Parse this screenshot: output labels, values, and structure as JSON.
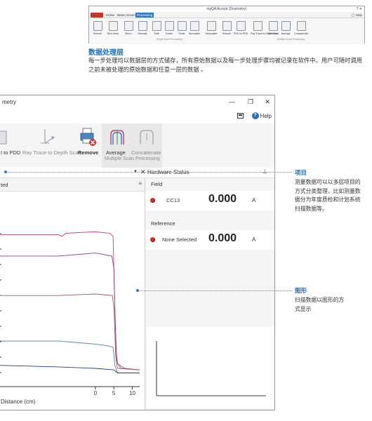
{
  "mini_window": {
    "title": "myQA Accept (Dosimetry)",
    "tabs": [
      "Home",
      "Beam Scanning",
      "Processing"
    ],
    "active_tab": "Processing",
    "tools": [
      "Smooth",
      "Bind ends",
      "Mirror",
      "Rescale",
      "Shift",
      "Center",
      "Scale",
      "Normalize",
      "Interpolate",
      "Smooth",
      "PDD to PDD",
      "Ray Trace to Depth Scan",
      "Remove",
      "Average",
      "Concatenate"
    ],
    "group_labels": [
      "Single Scan Processing",
      "Multiple Scan Processing"
    ]
  },
  "section": {
    "title": "数据处理层",
    "description": "每一步处理均以数据层的方式储存，所有原始数据以及每一步处理步骤均被记录在软件中。用户可随时调用之前未被处理的原始数据和任意一层的数据 。"
  },
  "window": {
    "title": "metry",
    "controls": {
      "minimize": "—",
      "restore": "❐",
      "close": "✕"
    },
    "help_label": "Help"
  },
  "ribbon": {
    "tools": [
      {
        "label": "I to PDD",
        "icon": "convert-to-pdd-icon"
      },
      {
        "label": "Ray Trace to Depth Scan",
        "icon": "ray-trace-icon"
      },
      {
        "label": "Remove",
        "icon": "printer-remove-icon"
      },
      {
        "label": "Average",
        "icon": "average-icon"
      },
      {
        "label": "Concatenate",
        "icon": "concatenate-icon"
      }
    ],
    "group_label": "Multiple Scan Processing"
  },
  "panel_header": {
    "hardware_title": "Hardware Status",
    "pin_glyph": "⊥"
  },
  "graph": {
    "header_text": "ted",
    "menu_glyph": "≡"
  },
  "hardware": {
    "field_label": "Field",
    "field_detector": "CC13",
    "field_value": "0.000",
    "field_unit": "A",
    "reference_label": "Reference",
    "reference_detector": "None Selected",
    "reference_value": "0.000",
    "reference_unit": "A"
  },
  "annotations": [
    {
      "title": "项目",
      "text": [
        "测量数据可以以多层项目的",
        "方式分类整理，比如测量数",
        "据分为年度质检和计划系统",
        "扫描数据等。"
      ]
    },
    {
      "title": "图形",
      "text": [
        "扫描数据以图形的方",
        "式显示"
      ]
    }
  ],
  "chart_data": {
    "type": "line",
    "xlabel": "Distance (cm)",
    "ylabel": "",
    "xlim": [
      -26,
      12
    ],
    "ylim": [
      0,
      110
    ],
    "x_ticks": [
      0,
      5,
      10
    ],
    "grid": false,
    "legend": "none",
    "series": [
      {
        "color": "#c04070",
        "values": [
          [
            -26,
            100
          ],
          [
            -10,
            100
          ],
          [
            -9,
            99
          ],
          [
            -8,
            101
          ],
          [
            0,
            102
          ],
          [
            4,
            101
          ],
          [
            4.8,
            99
          ],
          [
            5.2,
            60
          ],
          [
            5.6,
            25
          ],
          [
            6,
            15
          ],
          [
            8,
            12
          ],
          [
            12,
            11
          ]
        ]
      },
      {
        "color": "#8e3e8e",
        "values": [
          [
            -26,
            86
          ],
          [
            -10,
            86
          ],
          [
            0,
            88
          ],
          [
            4.5,
            86
          ],
          [
            5,
            78
          ],
          [
            5.4,
            40
          ],
          [
            5.8,
            16
          ],
          [
            7,
            12
          ],
          [
            12,
            11
          ]
        ]
      },
      {
        "color": "#9c5a5a",
        "values": [
          [
            -26,
            60
          ],
          [
            -10,
            60
          ],
          [
            0,
            61
          ],
          [
            4.6,
            60
          ],
          [
            5.1,
            50
          ],
          [
            5.5,
            20
          ],
          [
            6,
            12
          ],
          [
            12,
            11
          ]
        ]
      },
      {
        "color": "#4a7fb0",
        "values": [
          [
            -26,
            30
          ],
          [
            -10,
            30
          ],
          [
            0,
            28
          ],
          [
            3,
            27
          ],
          [
            4.8,
            26
          ],
          [
            5.3,
            14
          ],
          [
            6,
            9
          ],
          [
            12,
            9
          ]
        ]
      },
      {
        "color": "#203c80",
        "values": [
          [
            -26,
            14
          ],
          [
            -10,
            13
          ],
          [
            0,
            12
          ],
          [
            5,
            11
          ],
          [
            6,
            9
          ],
          [
            12,
            9
          ]
        ]
      }
    ]
  }
}
